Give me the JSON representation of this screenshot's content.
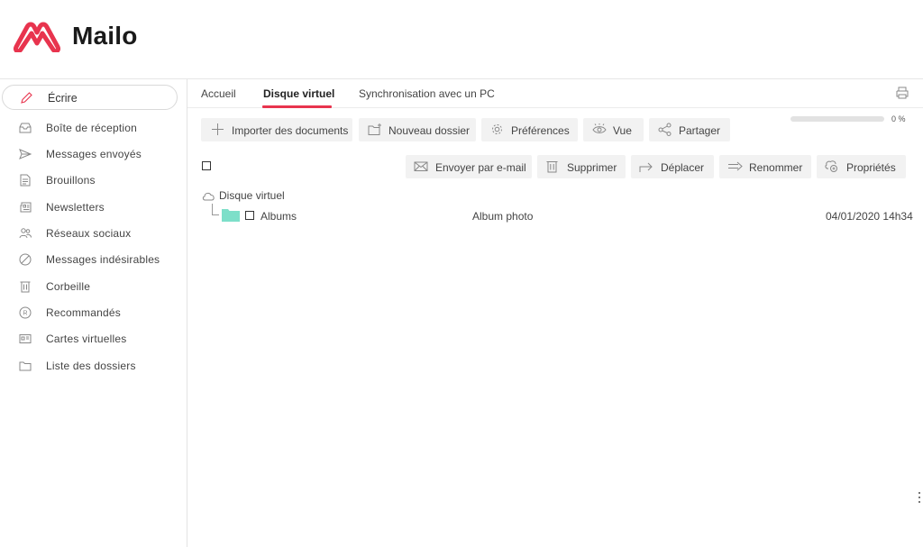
{
  "app": {
    "name": "Mailo",
    "brand_color": "#e8344e"
  },
  "sidebar": {
    "compose_label": "Écrire",
    "items": [
      {
        "label": "Boîte de réception",
        "icon": "inbox-icon"
      },
      {
        "label": "Messages envoyés",
        "icon": "send-icon"
      },
      {
        "label": "Brouillons",
        "icon": "draft-icon"
      },
      {
        "label": "Newsletters",
        "icon": "newsletter-icon"
      },
      {
        "label": "Réseaux sociaux",
        "icon": "people-icon"
      },
      {
        "label": "Messages indésirables",
        "icon": "block-icon"
      },
      {
        "label": "Corbeille",
        "icon": "trash-icon"
      },
      {
        "label": "Recommandés",
        "icon": "registered-icon"
      },
      {
        "label": "Cartes virtuelles",
        "icon": "card-icon"
      },
      {
        "label": "Liste des dossiers",
        "icon": "folder-icon"
      }
    ]
  },
  "tabs": [
    {
      "label": "Accueil",
      "active": false
    },
    {
      "label": "Disque virtuel",
      "active": true
    },
    {
      "label": "Synchronisation avec un PC",
      "active": false
    }
  ],
  "toolbar": {
    "import_label": "Importer des documents",
    "new_folder_label": "Nouveau dossier",
    "preferences_label": "Préférences",
    "view_label": "Vue",
    "share_label": "Partager"
  },
  "storage": {
    "percent_label": "0 %",
    "used_fraction": 0.0
  },
  "actions": {
    "email_label": "Envoyer par e-mail",
    "delete_label": "Supprimer",
    "move_label": "Déplacer",
    "rename_label": "Renommer",
    "properties_label": "Propriétés"
  },
  "tree": {
    "root_label": "Disque virtuel",
    "items": [
      {
        "name": "Albums",
        "type": "Album photo",
        "date": "04/01/2020 14h34",
        "folder_color": "#7ddfc9"
      }
    ]
  }
}
